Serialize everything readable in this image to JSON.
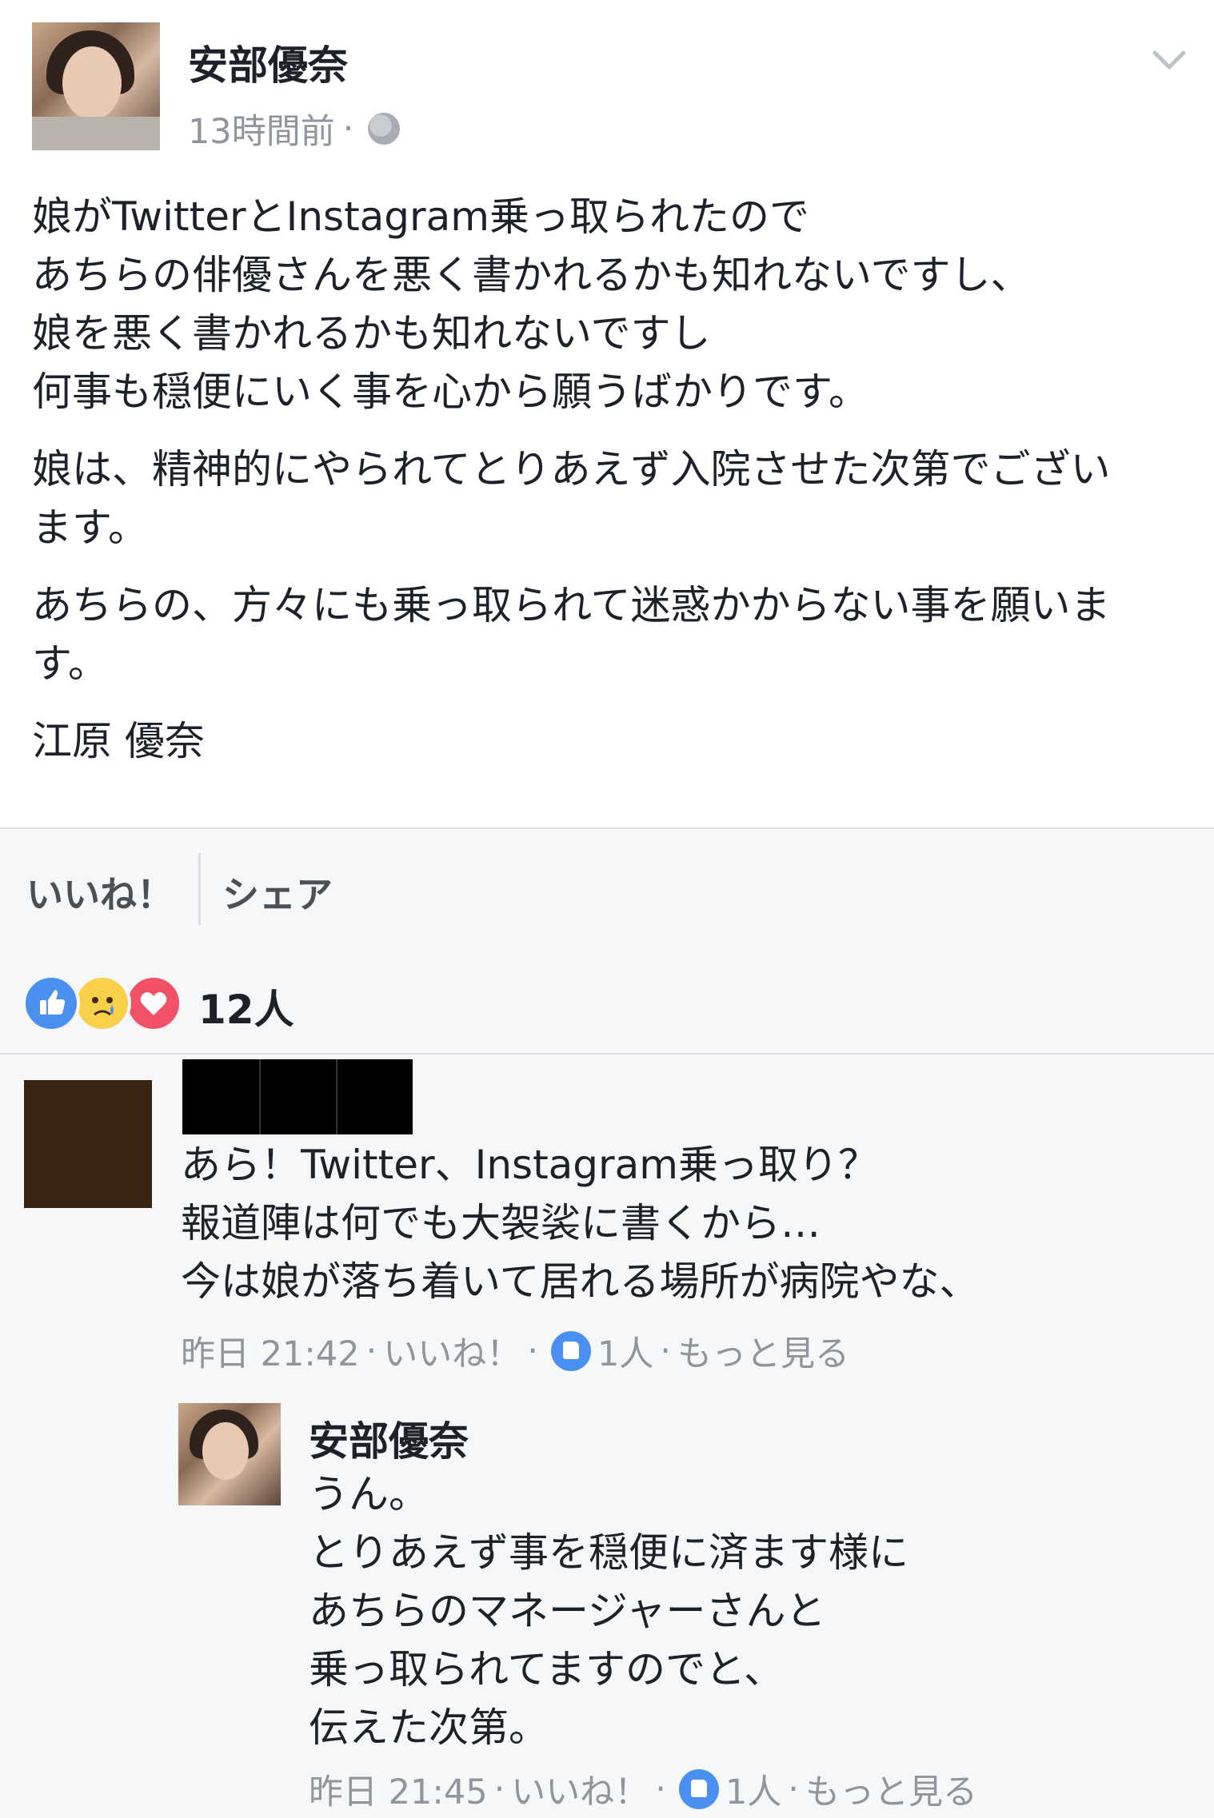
{
  "post": {
    "author": "安部優奈",
    "time": "13時間前",
    "separator": "·",
    "privacy_icon": "globe-icon",
    "menu_icon": "chevron-down-icon",
    "paragraphs": [
      [
        "娘がTwitterとInstagram乗っ取られたので",
        "あちらの俳優さんを悪く書かれるかも知れないですし、",
        "娘を悪く書かれるかも知れないですし",
        "何事も穏便にいく事を心から願うばかりです。"
      ],
      [
        "娘は、精神的にやられてとりあえず入院させた次第でござい",
        "ます。"
      ],
      [
        "あちらの、方々にも乗っ取られて迷惑かからない事を願いま",
        "す。"
      ],
      [
        "江原 優奈"
      ]
    ]
  },
  "actions": {
    "like_label": "いいね！",
    "share_label": "シェア"
  },
  "reactions": {
    "icons": [
      "like-reaction-icon",
      "sad-reaction-icon",
      "love-reaction-icon"
    ],
    "count": "12人"
  },
  "comments": [
    {
      "author_redacted": true,
      "lines": [
        "あら！Twitter、Instagram乗っ取り？",
        "報道陣は何でも大袈裟に書くから…",
        "今は娘が落ち着いて居れる場所が病院やな、"
      ],
      "time": "昨日 21:42",
      "like_label": "いいね！",
      "like_count": "1人",
      "more_label": "もっと見る"
    }
  ],
  "reply": {
    "author": "安部優奈",
    "lines": [
      "うん。",
      "とりあえず事を穏便に済ます様に",
      "あちらのマネージャーさんと",
      "乗っ取られてますのでと、",
      "伝えた次第。"
    ],
    "time": "昨日 21:45",
    "like_label": "いいね！",
    "like_count": "1人",
    "more_label": "もっと見る"
  },
  "colors": {
    "text": "#1d2129",
    "meta": "#90949c",
    "like_blue": "#4a90f0",
    "panel": "#f6f7f9",
    "divider": "#dddfe2"
  }
}
